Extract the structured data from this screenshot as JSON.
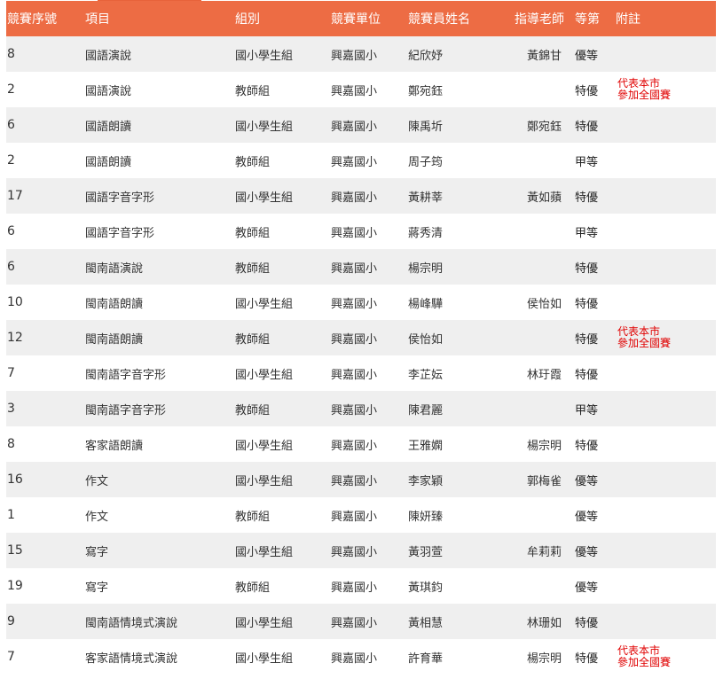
{
  "headers": {
    "id": "競賽序號",
    "item": "項目",
    "group": "組別",
    "unit": "競賽單位",
    "name": "競賽員姓名",
    "teacher": "指導老師",
    "rank": "等第",
    "note": "附註"
  },
  "rows": [
    {
      "id": "8",
      "item": "國語演說",
      "group": "國小學生組",
      "unit": "興嘉國小",
      "name": "紀欣妤",
      "teacher": "黃錦甘",
      "rank": "優等",
      "note1": "",
      "note2": ""
    },
    {
      "id": "2",
      "item": "國語演說",
      "group": "教師組",
      "unit": "興嘉國小",
      "name": "鄭宛鈺",
      "teacher": "",
      "rank": "特優",
      "note1": "代表本市",
      "note2": "參加全國賽"
    },
    {
      "id": "6",
      "item": "國語朗讀",
      "group": "國小學生組",
      "unit": "興嘉國小",
      "name": "陳禹圻",
      "teacher": "鄭宛鈺",
      "rank": "特優",
      "note1": "",
      "note2": ""
    },
    {
      "id": "2",
      "item": "國語朗讀",
      "group": "教師組",
      "unit": "興嘉國小",
      "name": "周子筠",
      "teacher": "",
      "rank": "甲等",
      "note1": "",
      "note2": ""
    },
    {
      "id": "17",
      "item": "國語字音字形",
      "group": "國小學生組",
      "unit": "興嘉國小",
      "name": "黃耕莘",
      "teacher": "黃如蘋",
      "rank": "特優",
      "note1": "",
      "note2": ""
    },
    {
      "id": "6",
      "item": "國語字音字形",
      "group": "教師組",
      "unit": "興嘉國小",
      "name": "蔣秀清",
      "teacher": "",
      "rank": "甲等",
      "note1": "",
      "note2": ""
    },
    {
      "id": "6",
      "item": "閩南語演說",
      "group": "教師組",
      "unit": "興嘉國小",
      "name": "楊宗明",
      "teacher": "",
      "rank": "特優",
      "note1": "",
      "note2": ""
    },
    {
      "id": "10",
      "item": "閩南語朗讀",
      "group": "國小學生組",
      "unit": "興嘉國小",
      "name": "楊峰驊",
      "teacher": "侯怡如",
      "rank": "特優",
      "note1": "",
      "note2": ""
    },
    {
      "id": "12",
      "item": "閩南語朗讀",
      "group": "教師組",
      "unit": "興嘉國小",
      "name": "侯怡如",
      "teacher": "",
      "rank": "特優",
      "note1": "代表本市",
      "note2": "參加全國賽"
    },
    {
      "id": "7",
      "item": "閩南語字音字形",
      "group": "國小學生組",
      "unit": "興嘉國小",
      "name": "李芷妘",
      "teacher": "林玗霞",
      "rank": "特優",
      "note1": "",
      "note2": ""
    },
    {
      "id": "3",
      "item": "閩南語字音字形",
      "group": "教師組",
      "unit": "興嘉國小",
      "name": "陳君麗",
      "teacher": "",
      "rank": "甲等",
      "note1": "",
      "note2": ""
    },
    {
      "id": "8",
      "item": "客家語朗讀",
      "group": "國小學生組",
      "unit": "興嘉國小",
      "name": "王雅嫻",
      "teacher": "楊宗明",
      "rank": "特優",
      "note1": "",
      "note2": ""
    },
    {
      "id": "16",
      "item": "作文",
      "group": "國小學生組",
      "unit": "興嘉國小",
      "name": "李家穎",
      "teacher": "郭梅雀",
      "rank": "優等",
      "note1": "",
      "note2": ""
    },
    {
      "id": "1",
      "item": "作文",
      "group": "教師組",
      "unit": "興嘉國小",
      "name": "陳妍臻",
      "teacher": "",
      "rank": "優等",
      "note1": "",
      "note2": ""
    },
    {
      "id": "15",
      "item": "寫字",
      "group": "國小學生組",
      "unit": "興嘉國小",
      "name": "黃羽萱",
      "teacher": "牟莉莉",
      "rank": "優等",
      "note1": "",
      "note2": ""
    },
    {
      "id": "19",
      "item": "寫字",
      "group": "教師組",
      "unit": "興嘉國小",
      "name": "黃琪鈞",
      "teacher": "",
      "rank": "優等",
      "note1": "",
      "note2": ""
    },
    {
      "id": "9",
      "item": "閩南語情境式演說",
      "group": "國小學生組",
      "unit": "興嘉國小",
      "name": "黃相慧",
      "teacher": "林珊如",
      "rank": "特優",
      "note1": "",
      "note2": ""
    },
    {
      "id": "7",
      "item": "客家語情境式演說",
      "group": "國小學生組",
      "unit": "興嘉國小",
      "name": "許育華",
      "teacher": "楊宗明",
      "rank": "特優",
      "note1": "代表本市",
      "note2": "參加全國賽"
    }
  ]
}
